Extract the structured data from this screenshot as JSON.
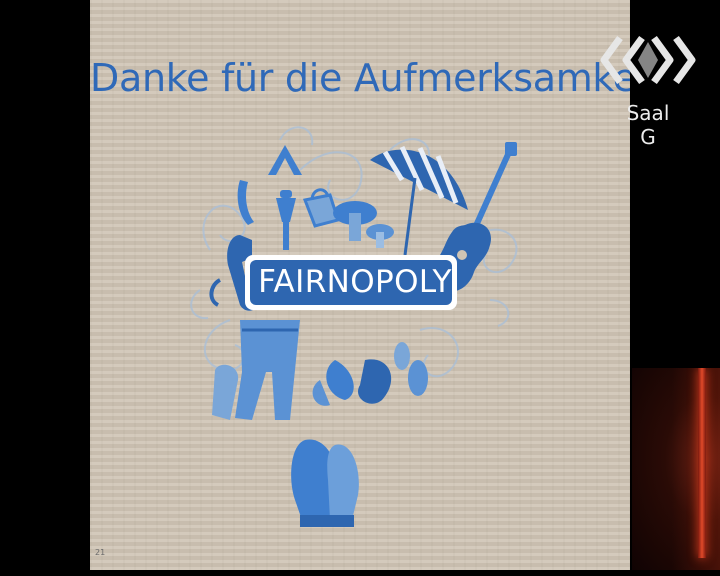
{
  "slide": {
    "title": "Danke für die Aufmerksamkeit!",
    "logo_text": "FAIRNOPOLY",
    "footnote": "21"
  },
  "overlay": {
    "room_label": "Saal G"
  },
  "colors": {
    "title_blue": "#2f69b8",
    "illustration_blue": "#3f7fcf",
    "logo_blue": "#2e66b0",
    "background_tan": "#cfc4b4"
  },
  "icons": [
    "umbrella-icon",
    "guitar-icon",
    "boxing-gloves-icon",
    "mushroom-icon",
    "telephone-icon",
    "jeans-icon",
    "lamp-icon",
    "leaf-icon",
    "room-logo-icon"
  ]
}
